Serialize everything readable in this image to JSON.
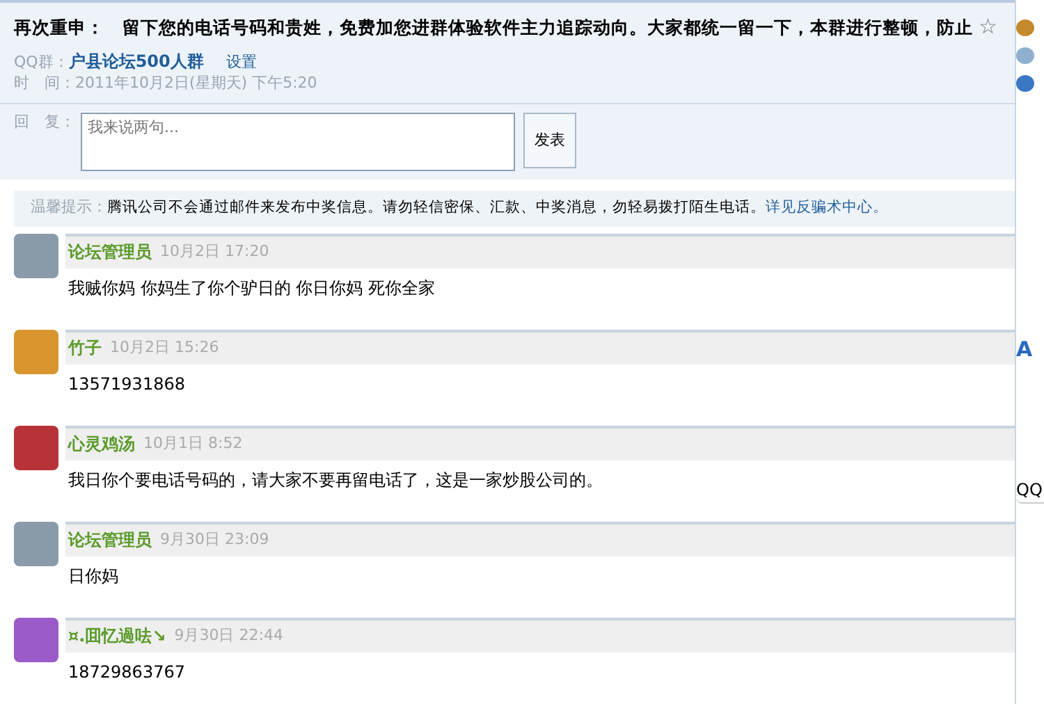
{
  "topic": {
    "title": "再次重申：　留下您的电话号码和贵姓，免费加您进群体验软件主力追踪动向。大家都统一留一下，本群进行整顿，防止",
    "star": "☆",
    "group_label": "QQ群：",
    "group_name": "户县论坛500人群",
    "settings": "设置",
    "time": "时　间：2011年10月2日(星期天) 下午5:20"
  },
  "reply": {
    "label": "回　复：",
    "placeholder": "我来说两句...",
    "submit": "发表"
  },
  "notice": {
    "label": "温馨提示：",
    "text": "腾讯公司不会通过邮件来发布中奖信息。请勿轻信密保、汇款、中奖消息，勿轻易拨打陌生电话。",
    "link": "详见反骗术中心。"
  },
  "posts": [
    {
      "author": "论坛管理员",
      "time": "10月2日 17:20",
      "body": "我贼你妈  你妈生了你个驴日的   你日你妈  死你全家",
      "color": "#8a9aa8"
    },
    {
      "author": "竹子",
      "time": "10月2日 15:26",
      "body": "13571931868",
      "color": "#d9962e"
    },
    {
      "author": "心灵鸡汤",
      "time": "10月1日 8:52",
      "body": "我日你个要电话号码的，请大家不要再留电话了，这是一家炒股公司的。",
      "color": "#b8323a"
    },
    {
      "author": "论坛管理员",
      "time": "9月30日 23:09",
      "body": "日你妈",
      "color": "#8a9aa8"
    },
    {
      "author": "¤.囬忆過呿↘",
      "time": "9月30日 22:44",
      "body": "18729863767",
      "color": "#9b5bc9"
    }
  ],
  "side_panel": {
    "letter": "A",
    "label": "QQ"
  }
}
